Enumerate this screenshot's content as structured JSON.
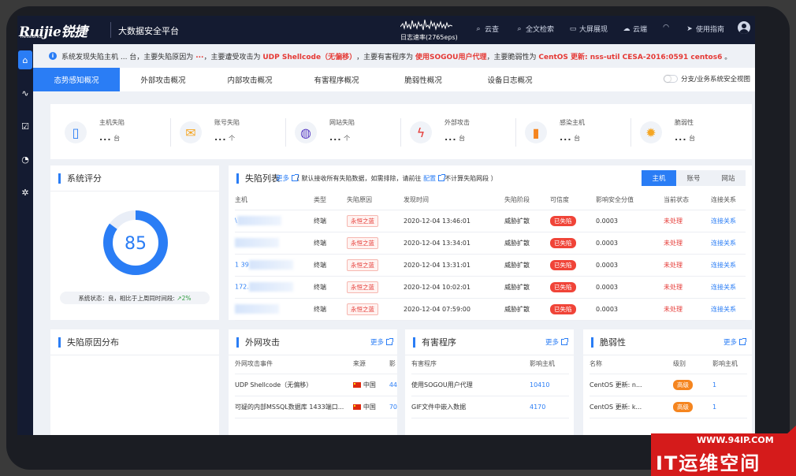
{
  "header": {
    "logo": "Ruijie锐捷",
    "logo_sub": "networks",
    "product": "大数据安全平台",
    "log_rate": "日志速率(2765eps)",
    "nav": [
      {
        "icon": "search-icon",
        "label": "云查"
      },
      {
        "icon": "search-icon",
        "label": "全文检索"
      },
      {
        "icon": "monitor-icon",
        "label": "大屏展现"
      },
      {
        "icon": "cloud-icon",
        "label": "云端"
      },
      {
        "icon": "headset-icon",
        "label": ""
      },
      {
        "icon": "send-icon",
        "label": "使用指南"
      }
    ]
  },
  "sidebar": {
    "items": [
      {
        "icon": "home-icon",
        "active": true
      },
      {
        "icon": "pulse-icon",
        "active": false
      },
      {
        "icon": "clipboard-icon",
        "active": false
      },
      {
        "icon": "pie-icon",
        "active": false
      },
      {
        "icon": "gear-icon",
        "active": false
      }
    ]
  },
  "notice": {
    "t1": "系统发现失陷主机 ... 台，主要失陷原因为",
    "t2": "...",
    "t3": "，主要遭受攻击为",
    "t4": "UDP Shellcode（无偏移）",
    "t5": "，主要有害程序为",
    "t6": "使用SOGOU用户代理",
    "t7": "，主要脆弱性为",
    "t8": "CentOS 更新: nss-util CESA-2016:0591 centos6",
    "t9": "。"
  },
  "tabs": [
    "态势感知概况",
    "外部攻击概况",
    "内部攻击概况",
    "有害程序概况",
    "脆弱性概况",
    "设备日志概况"
  ],
  "toggle_label": "分支/业务系统安全视图",
  "stats": [
    {
      "icon": "host-icon",
      "label": "主机失陷",
      "value": "...",
      "unit": "台",
      "color": "#2a7df5"
    },
    {
      "icon": "mail-icon",
      "label": "账号失陷",
      "value": "...",
      "unit": "个",
      "color": "#f5a623"
    },
    {
      "icon": "globe-icon",
      "label": "网站失陷",
      "value": "...",
      "unit": "个",
      "color": "#5b3fc4"
    },
    {
      "icon": "lightning-icon",
      "label": "外部攻击",
      "value": "...",
      "unit": "台",
      "color": "#e53935"
    },
    {
      "icon": "phone-icon",
      "label": "感染主机",
      "value": "...",
      "unit": "台",
      "color": "#f5851f"
    },
    {
      "icon": "bug-icon",
      "label": "脆弱性",
      "value": "...",
      "unit": "台",
      "color": "#f5a623"
    }
  ],
  "score": {
    "title": "系统评分",
    "value": "85",
    "fraction": 0.85,
    "status_label": "系统状态：",
    "status_value": "良",
    "compare": "，相比于上周同时间段:",
    "change": "2%"
  },
  "lost": {
    "title": "失陷列表",
    "more": "更多",
    "note1": "（ 默认接收所有失陷数据，如需排除，请前往",
    "note_link": "配置",
    "note2": "不计算失陷网段 ）",
    "seg": [
      "主机",
      "账号",
      "网站"
    ],
    "columns": [
      "主机",
      "类型",
      "失陷原因",
      "发现时间",
      "失陷阶段",
      "可信度",
      "影响安全分值",
      "当前状态",
      "连接关系"
    ],
    "rows": [
      {
        "host": "\\",
        "type": "终端",
        "reason": "永恒之蓝",
        "time": "2020-12-04 13:46:01",
        "stage": "威胁扩散",
        "cred": "已失陷",
        "score": "0.0003",
        "state": "未处理",
        "link": "连接关系"
      },
      {
        "host": "",
        "type": "终端",
        "reason": "永恒之蓝",
        "time": "2020-12-04 13:34:01",
        "stage": "威胁扩散",
        "cred": "已失陷",
        "score": "0.0003",
        "state": "未处理",
        "link": "连接关系"
      },
      {
        "host": "1 39",
        "type": "终端",
        "reason": "永恒之蓝",
        "time": "2020-12-04 13:31:01",
        "stage": "威胁扩散",
        "cred": "已失陷",
        "score": "0.0003",
        "state": "未处理",
        "link": "连接关系"
      },
      {
        "host": "172.",
        "type": "终端",
        "reason": "永恒之蓝",
        "time": "2020-12-04 10:02:01",
        "stage": "威胁扩散",
        "cred": "已失陷",
        "score": "0.0003",
        "state": "未处理",
        "link": "连接关系"
      },
      {
        "host": "",
        "type": "终端",
        "reason": "永恒之蓝",
        "time": "2020-12-04 07:59:00",
        "stage": "威胁扩散",
        "cred": "已失陷",
        "score": "0.0003",
        "state": "未处理",
        "link": "连接关系"
      }
    ]
  },
  "causes": {
    "title": "失陷原因分布"
  },
  "external": {
    "title": "外网攻击",
    "more": "更多",
    "columns": [
      "外网攻击事件",
      "来源",
      "影"
    ],
    "rows": [
      {
        "event": "UDP Shellcode（无偏移）",
        "source": "中国",
        "count": "44"
      },
      {
        "event": "可疑的内部MSSQL数据库 1433端口...",
        "source": "中国",
        "count": "70"
      }
    ]
  },
  "harmful": {
    "title": "有害程序",
    "more": "更多",
    "columns": [
      "有害程序",
      "影响主机"
    ],
    "rows": [
      {
        "name": "使用SOGOU用户代理",
        "count": "10410"
      },
      {
        "name": "GIF文件中嵌入数据",
        "count": "4170"
      }
    ]
  },
  "vuln": {
    "title": "脆弱性",
    "more": "更多",
    "columns": [
      "名称",
      "级别",
      "影响主机"
    ],
    "rows": [
      {
        "name": "CentOS 更新: n...",
        "level": "高级",
        "count": "1"
      },
      {
        "name": "CentOS 更新: k...",
        "level": "高级",
        "count": "1"
      }
    ]
  },
  "watermark": {
    "site": "WWW.94IP.COM",
    "name": "IT运维空间"
  }
}
